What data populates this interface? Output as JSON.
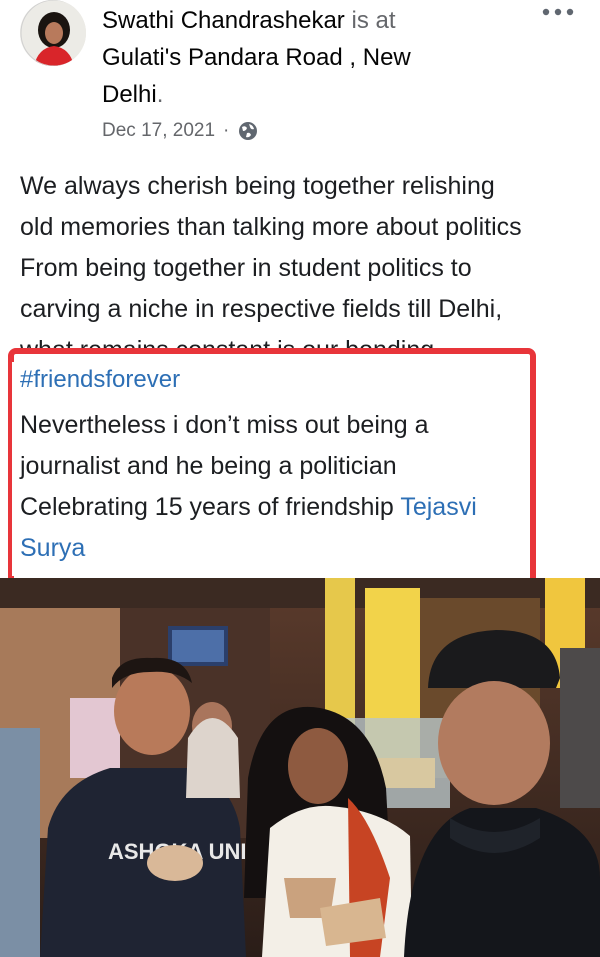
{
  "post": {
    "author": "Swathi Chandrashekar",
    "connector": " is at",
    "location_line1": "Gulati's Pandara Road , New",
    "location_line2": "Delhi",
    "location_end": ".",
    "date": "Dec 17, 2021",
    "separator": "·",
    "privacy_icon": "globe-icon",
    "more_icon": "more-options-icon",
    "body_lines": [
      "We always cherish being together relishing",
      "old memories than talking more about politics",
      "From being together in student politics to",
      "carving a niche in respective fields till Delhi,",
      "what remains constant is our bonding"
    ],
    "hashtag": "#friendsforever",
    "quote_lines": [
      "Nevertheless i don’t miss out being a",
      "journalist and he being a politician",
      "Celebrating 15 years of friendship "
    ],
    "mention_part1": "Tejasvi",
    "mention_part2": "Surya",
    "photo_text": "ASHOKA UNIV"
  },
  "colors": {
    "highlight_border": "#e8353a",
    "link": "#2d6fb5",
    "secondary_text": "#65676b"
  }
}
